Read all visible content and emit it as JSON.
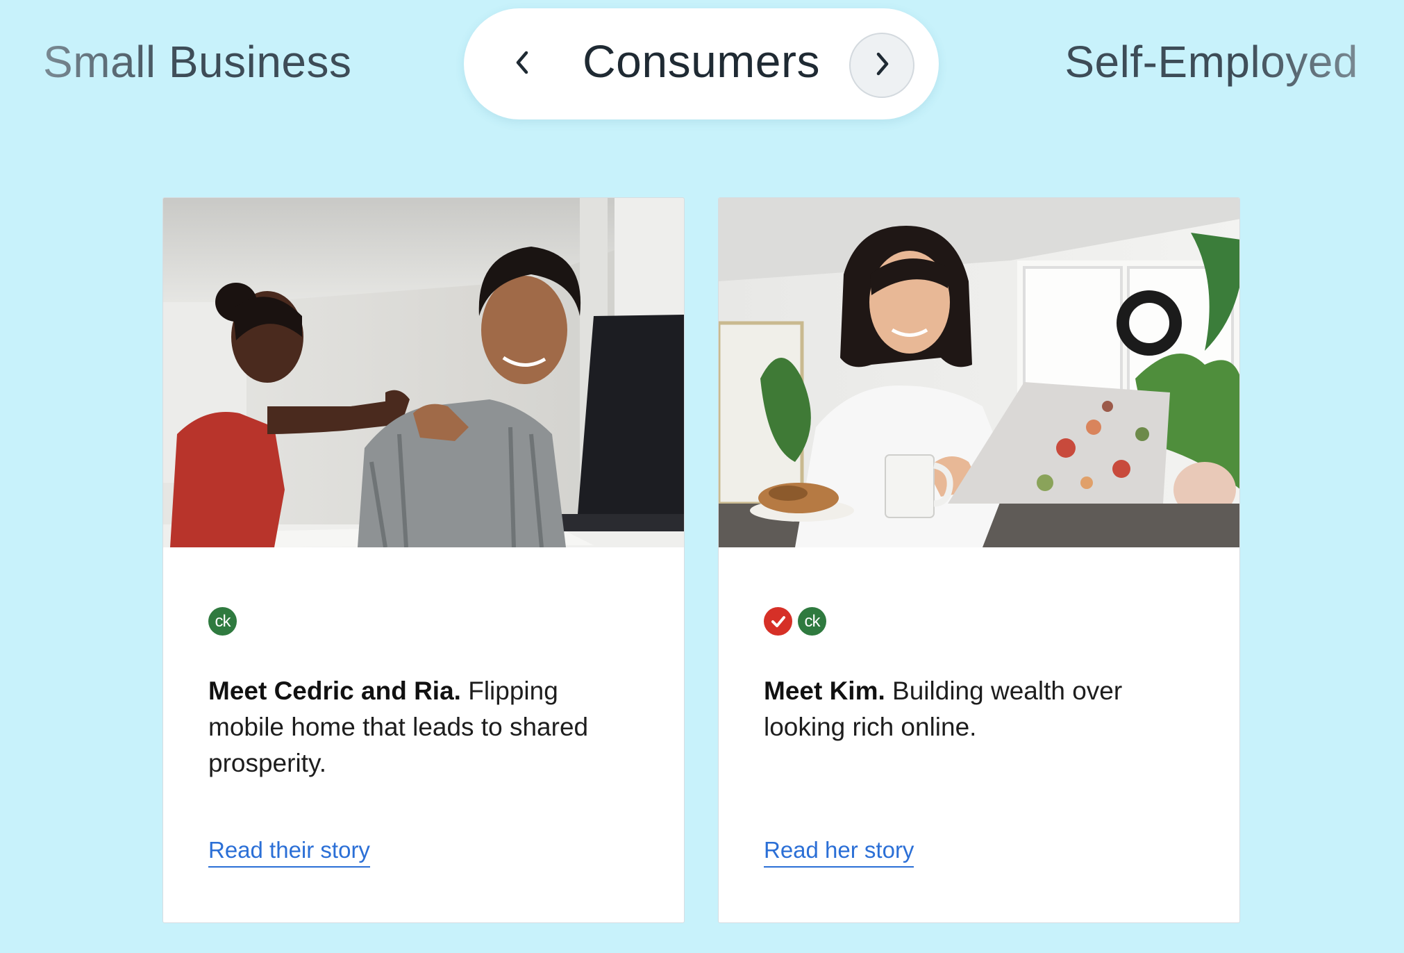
{
  "segments": {
    "previous_label": "Small Business",
    "current_label": "Consumers",
    "next_label": "Self-Employed",
    "prev_icon": "chevron-left-icon",
    "next_icon": "chevron-right-icon"
  },
  "cards": [
    {
      "photo_alt": "Couple fist bumping at laptop",
      "badges": [
        {
          "icon": "credit-karma-icon",
          "text": "ck",
          "color": "#2f7a3f"
        }
      ],
      "headline_bold": "Meet Cedric and Ria.",
      "headline_rest": "Flipping mobile home that leads to shared prosperity.",
      "link_label": "Read their story"
    },
    {
      "photo_alt": "Woman working on laptop",
      "badges": [
        {
          "icon": "turbotax-icon",
          "text": "",
          "color": "#d63027"
        },
        {
          "icon": "credit-karma-icon",
          "text": "ck",
          "color": "#2f7a3f"
        }
      ],
      "headline_bold": "Meet Kim.",
      "headline_rest": "Building wealth over looking rich online.",
      "link_label": "Read her story"
    }
  ],
  "colors": {
    "background": "#c8f2fb",
    "link": "#2b6fd6",
    "card": "#ffffff",
    "text": "#1d1d1d"
  }
}
